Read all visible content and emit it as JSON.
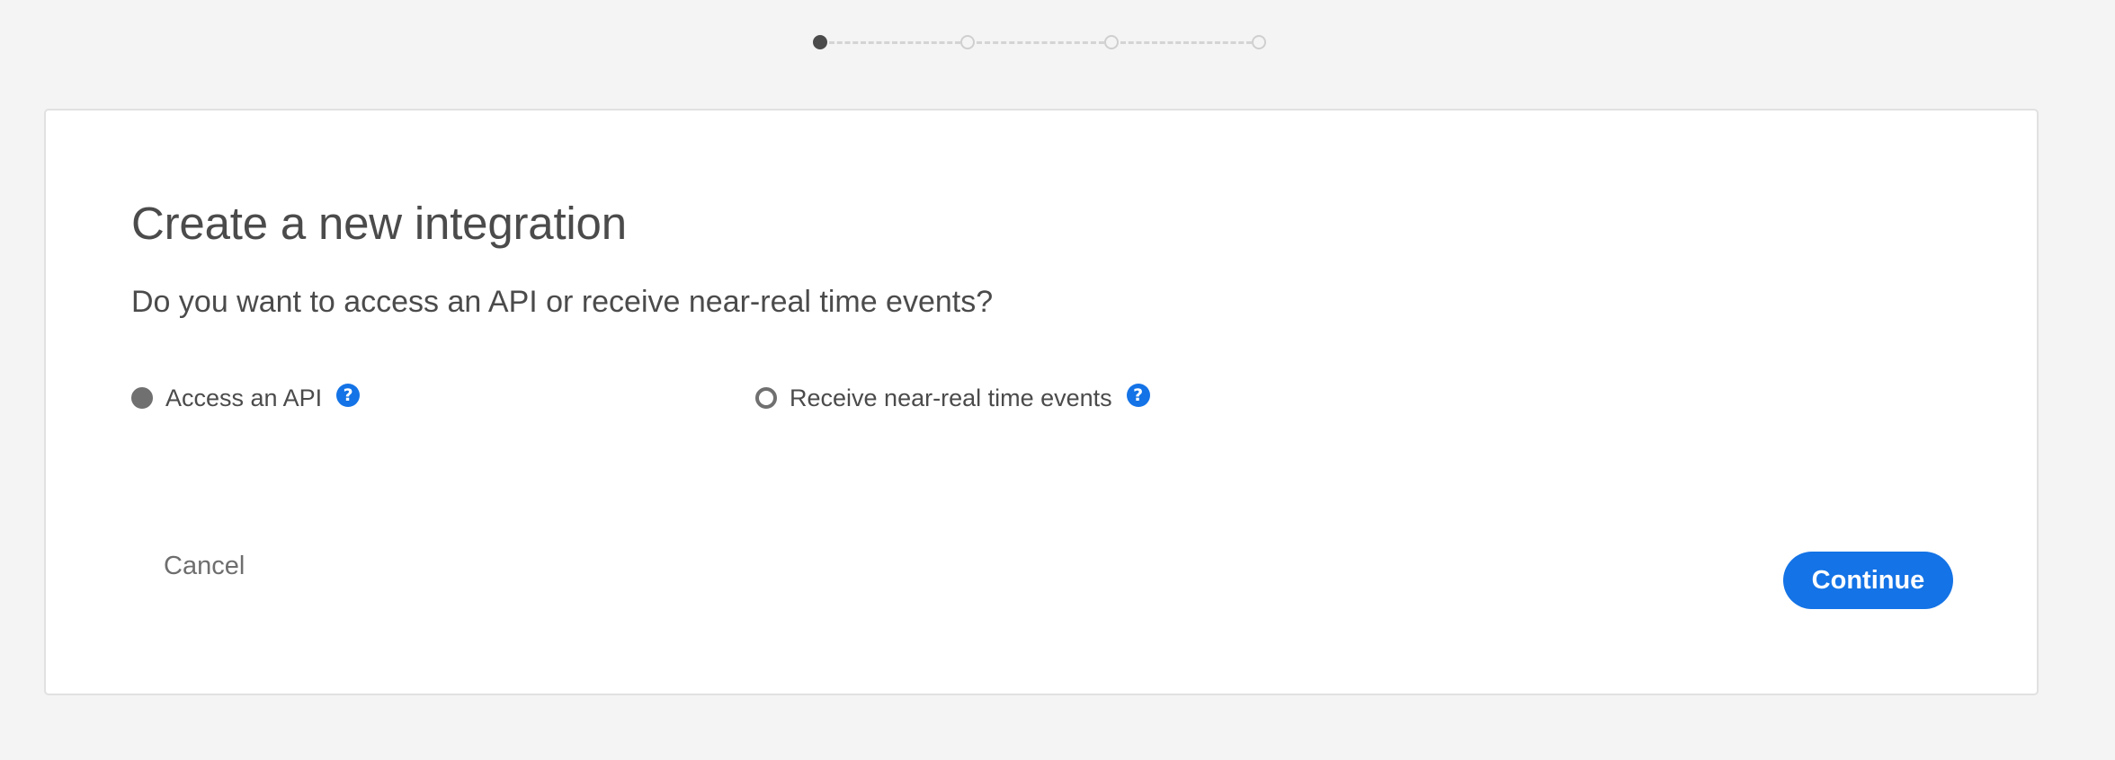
{
  "stepper": {
    "steps": [
      {
        "state": "active"
      },
      {
        "state": "inactive"
      },
      {
        "state": "inactive"
      },
      {
        "state": "inactive"
      }
    ],
    "current_step": 1,
    "total_steps": 4
  },
  "card": {
    "title": "Create a new integration",
    "question": "Do you want to access an API or receive near-real time events?",
    "options": [
      {
        "label": "Access an API",
        "selected": true,
        "help_icon": "question-circle-icon"
      },
      {
        "label": "Receive near-real time events",
        "selected": false,
        "help_icon": "question-circle-icon"
      }
    ],
    "help_glyph": "?",
    "cancel_label": "Cancel",
    "continue_label": "Continue"
  },
  "colors": {
    "accent": "#1473e6",
    "background": "#f4f4f4",
    "text": "#4b4b4b",
    "radio": "#707070"
  }
}
